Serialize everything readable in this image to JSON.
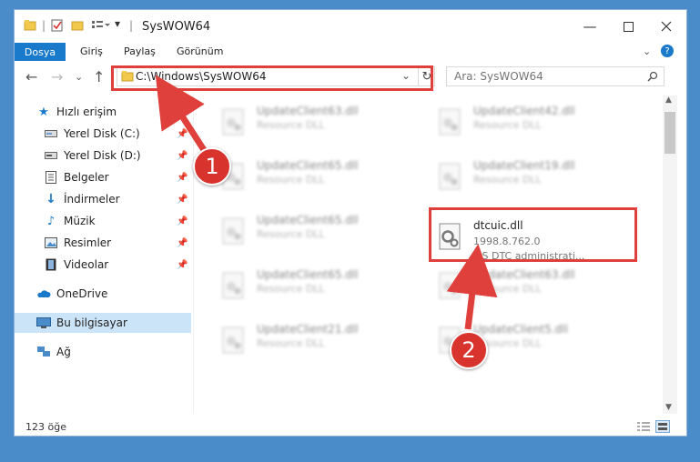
{
  "window": {
    "title": "SysWOW64",
    "controls": [
      "minimize-icon",
      "maximize-icon",
      "close-icon"
    ]
  },
  "ribbon": {
    "tabs": [
      "Dosya",
      "Giriş",
      "Paylaş",
      "Görünüm"
    ]
  },
  "address": {
    "path": "C:\\Windows\\SysWOW64",
    "search_placeholder": "Ara: SysWOW64"
  },
  "sidebar": {
    "items": [
      {
        "label": "Hızlı erişim",
        "icon": "star-icon"
      },
      {
        "label": "Yerel Disk (C:)",
        "icon": "drive-icon",
        "pinned": true
      },
      {
        "label": "Yerel Disk (D:)",
        "icon": "drive-icon",
        "pinned": true
      },
      {
        "label": "Belgeler",
        "icon": "documents-icon",
        "pinned": true
      },
      {
        "label": "İndirmeler",
        "icon": "download-icon",
        "pinned": true
      },
      {
        "label": "Müzik",
        "icon": "music-icon",
        "pinned": true
      },
      {
        "label": "Resimler",
        "icon": "pictures-icon",
        "pinned": true
      },
      {
        "label": "Videolar",
        "icon": "videos-icon",
        "pinned": true
      },
      {
        "label": "OneDrive",
        "icon": "cloud-icon"
      },
      {
        "label": "Bu bilgisayar",
        "icon": "computer-icon",
        "selected": true
      },
      {
        "label": "Ağ",
        "icon": "network-icon"
      }
    ]
  },
  "files": [
    {
      "name": "UpdateClient63.dll",
      "type": "Resource DLL"
    },
    {
      "name": "UpdateClient42.dll",
      "type": "Resource DLL"
    },
    {
      "name": "UpdateClient65.dll",
      "type": "Resource DLL"
    },
    {
      "name": "UpdateClient19.dll",
      "type": "Resource DLL"
    },
    {
      "name": "UpdateClient65.dll",
      "type": "Resource DLL"
    },
    {
      "name": "dtcuic.dll",
      "version": "1998.8.762.0",
      "type": "MS DTC administrati..."
    },
    {
      "name": "UpdateClient65.dll",
      "type": "Resource DLL"
    },
    {
      "name": "UpdateClient63.dll",
      "type": "Resource DLL"
    },
    {
      "name": "UpdateClient21.dll",
      "type": "Resource DLL"
    },
    {
      "name": "UpdateClient5.dll",
      "type": "Resource DLL"
    }
  ],
  "status": {
    "count": "123 öğe"
  },
  "annotations": {
    "step1": "1",
    "step2": "2",
    "color": "#e0403c"
  },
  "colors": {
    "accent": "#1979ca",
    "selection": "#cce4f7"
  }
}
